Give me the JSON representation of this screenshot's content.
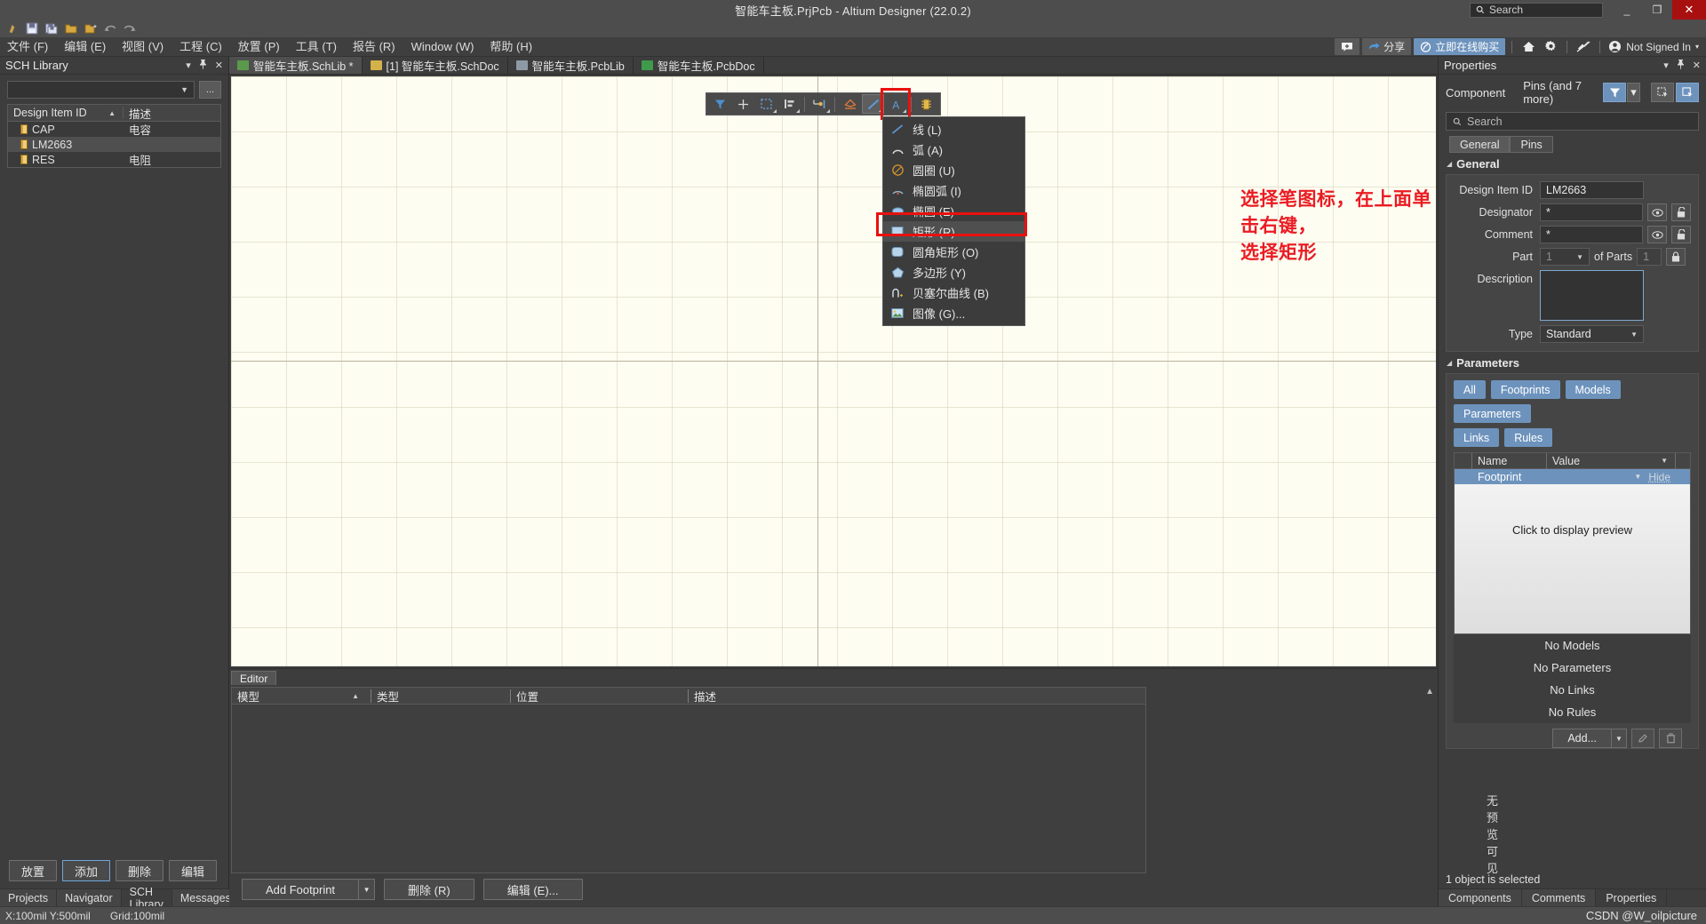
{
  "window": {
    "title": "智能车主板.PrjPcb - Altium Designer (22.0.2)",
    "minimize": "_",
    "restore": "❐",
    "close": "✕"
  },
  "search": {
    "placeholder": "Search",
    "icon": "search-icon"
  },
  "quick_toolbar": [
    {
      "name": "altium-logo-icon",
      "glyph": "◉"
    },
    {
      "name": "save-icon",
      "glyph": "▤"
    },
    {
      "name": "save-all-icon",
      "glyph": "▥"
    },
    {
      "name": "open-icon",
      "glyph": "🗁"
    },
    {
      "name": "open-project-icon",
      "glyph": "🗀"
    },
    {
      "name": "undo-icon",
      "glyph": "↶"
    },
    {
      "name": "redo-icon",
      "glyph": "↷"
    }
  ],
  "menubar": {
    "items": [
      {
        "label": "文件 (F)"
      },
      {
        "label": "编辑 (E)"
      },
      {
        "label": "视图 (V)"
      },
      {
        "label": "工程 (C)"
      },
      {
        "label": "放置 (P)"
      },
      {
        "label": "工具 (T)"
      },
      {
        "label": "报告 (R)"
      },
      {
        "label": "Window (W)"
      },
      {
        "label": "帮助 (H)"
      }
    ],
    "right": {
      "feedback_icon": "comment-plus-icon",
      "share_label": "分享",
      "share_icon": "share-arrow-icon",
      "buy_label": "立即在线购买",
      "buy_icon": "cart-icon",
      "home_icon": "home-icon",
      "settings_icon": "gear-icon",
      "connect_icon": "plug-icon",
      "account_icon": "user-icon",
      "account_label": "Not Signed In",
      "account_caret": "▾"
    }
  },
  "sch_library": {
    "title": "SCH Library",
    "header_controls": {
      "menu": "▾",
      "pin": "📌",
      "close": "✕"
    },
    "filter": {
      "value": "",
      "placeholder": "",
      "dots_label": "..."
    },
    "columns": [
      {
        "label": "Design Item ID",
        "sort": "▲"
      },
      {
        "label": "描述"
      }
    ],
    "rows": [
      {
        "icon": "component-icon",
        "id": "CAP",
        "desc": "电容",
        "selected": false
      },
      {
        "icon": "component-icon",
        "id": "LM2663",
        "desc": "",
        "selected": true
      },
      {
        "icon": "component-icon",
        "id": "RES",
        "desc": "电阻",
        "selected": false
      }
    ],
    "buttons": [
      {
        "label": "放置",
        "focus": false
      },
      {
        "label": "添加",
        "focus": true
      },
      {
        "label": "删除",
        "focus": false
      },
      {
        "label": "编辑",
        "focus": false
      }
    ],
    "panel_tabs": [
      {
        "label": "Projects",
        "active": false
      },
      {
        "label": "Navigator",
        "active": false
      },
      {
        "label": "SCH Library",
        "active": true
      },
      {
        "label": "Messages",
        "active": false
      }
    ]
  },
  "document_tabs": [
    {
      "label": "智能车主板.SchLib *",
      "icon": "schlib-icon",
      "color": "#5b9a4c",
      "active": true
    },
    {
      "label": "[1] 智能车主板.SchDoc",
      "icon": "schdoc-icon",
      "color": "#d4b24a",
      "active": false
    },
    {
      "label": "智能车主板.PcbLib",
      "icon": "pcblib-icon",
      "color": "#8d9aa6",
      "active": false
    },
    {
      "label": "智能车主板.PcbDoc",
      "icon": "pcbdoc-icon",
      "color": "#3f9a4c",
      "active": false
    }
  ],
  "drawing_toolbar": {
    "items": [
      {
        "name": "filter-icon",
        "glyph": "▼",
        "color": "#4e8fd0",
        "active": false,
        "corner": false
      },
      {
        "name": "crosshair-icon",
        "glyph": "✛",
        "color": "#d8d8d8",
        "active": false,
        "corner": false
      },
      {
        "name": "select-area-icon",
        "glyph": "▢",
        "color": "#6da4dd",
        "active": false,
        "corner": true
      },
      {
        "name": "align-icon",
        "glyph": "▤",
        "color": "#cfcfcf",
        "active": false,
        "corner": true
      },
      {
        "name": "place-pin-icon",
        "glyph": "⊷",
        "color": "#e0b84c",
        "active": false,
        "corner": true
      },
      {
        "name": "place-part-icon",
        "glyph": "◇",
        "color": "#e07a3c",
        "active": false,
        "corner": false
      },
      {
        "name": "draw-line-icon",
        "glyph": "╱",
        "color": "#5e9ad8",
        "active": true,
        "corner": true
      },
      {
        "name": "place-text-icon",
        "glyph": "A",
        "color": "#5e9ad8",
        "active": false,
        "corner": true
      },
      {
        "name": "place-ic-icon",
        "glyph": "▮",
        "color": "#e0b84c",
        "active": false,
        "corner": false
      }
    ]
  },
  "draw_menu": {
    "items": [
      {
        "label": "线 (L)",
        "icon": "line-icon",
        "selected": false
      },
      {
        "label": "弧 (A)",
        "icon": "arc-icon",
        "selected": false
      },
      {
        "label": "圆圈 (U)",
        "icon": "circle-icon",
        "selected": false
      },
      {
        "label": "椭圆弧 (I)",
        "icon": "elliptical-arc-icon",
        "selected": false
      },
      {
        "label": "椭圆 (E)",
        "icon": "ellipse-icon",
        "selected": false
      },
      {
        "label": "矩形 (R)",
        "icon": "rectangle-icon",
        "selected": true
      },
      {
        "label": "圆角矩形 (O)",
        "icon": "round-rect-icon",
        "selected": false
      },
      {
        "label": "多边形 (Y)",
        "icon": "polygon-icon",
        "selected": false
      },
      {
        "label": "贝塞尔曲线 (B)",
        "icon": "bezier-icon",
        "selected": false
      },
      {
        "label": "图像 (G)...",
        "icon": "image-icon",
        "selected": false
      }
    ]
  },
  "annotation": {
    "text": "选择笔图标，在上面单击右键，\n选择矩形",
    "color": "#ea1c23"
  },
  "editor_pane": {
    "tab": "Editor",
    "columns": [
      {
        "label": "模型",
        "sort": "▲"
      },
      {
        "label": "类型"
      },
      {
        "label": "位置"
      },
      {
        "label": "描述"
      }
    ],
    "rows": [],
    "no_preview": "无预览可见",
    "buttons": {
      "add_footprint": "Add Footprint",
      "delete": "删除 (R)",
      "edit": "编辑 (E)..."
    }
  },
  "properties": {
    "title": "Properties",
    "header_controls": {
      "menu": "▾",
      "pin": "📌",
      "close": "✕"
    },
    "object_type": "Component",
    "object_count": "Pins (and 7 more)",
    "filter_icon": "funnel-icon",
    "filter_caret": "▾",
    "select_icon_1": "select-similar-icon",
    "select_icon_2": "select-all-icon",
    "search": {
      "placeholder": "Search",
      "icon": "search-icon"
    },
    "tabs": [
      {
        "label": "General",
        "active": true
      },
      {
        "label": "Pins",
        "active": false
      }
    ],
    "general": {
      "section_title": "General",
      "fields": {
        "design_item_id_label": "Design Item ID",
        "design_item_id_value": "LM2663",
        "designator_label": "Designator",
        "designator_value": "*",
        "comment_label": "Comment",
        "comment_value": "*",
        "part_label": "Part",
        "part_value": "1",
        "of_parts_label": "of Parts",
        "of_parts_value": "1",
        "description_label": "Description",
        "description_value": "",
        "type_label": "Type",
        "type_value": "Standard"
      },
      "icons": {
        "eye": "eye-icon",
        "unlock": "unlock-icon",
        "lock": "lock-icon",
        "caret": "▾"
      }
    },
    "parameters": {
      "section_title": "Parameters",
      "pills": [
        "All",
        "Footprints",
        "Models",
        "Parameters",
        "Links",
        "Rules"
      ],
      "columns": [
        "",
        "Name",
        "Value",
        ""
      ],
      "rows": [
        {
          "name": "Footprint",
          "value": "",
          "hide": "Hide"
        }
      ],
      "preview_text": "Click to display preview",
      "empty_states": [
        "No Models",
        "No Parameters",
        "No Links",
        "No Rules"
      ],
      "add_label": "Add...",
      "add_caret": "▾",
      "edit_icon": "pencil-icon",
      "delete_icon": "trash-icon"
    },
    "status": "1 object is selected",
    "bottom_tabs": [
      {
        "label": "Components",
        "active": false
      },
      {
        "label": "Comments",
        "active": false
      },
      {
        "label": "Properties",
        "active": true
      }
    ]
  },
  "statusbar": {
    "coords": "X:100mil Y:500mil",
    "grid": "Grid:100mil",
    "watermark": "CSDN @W_oilpicture"
  }
}
